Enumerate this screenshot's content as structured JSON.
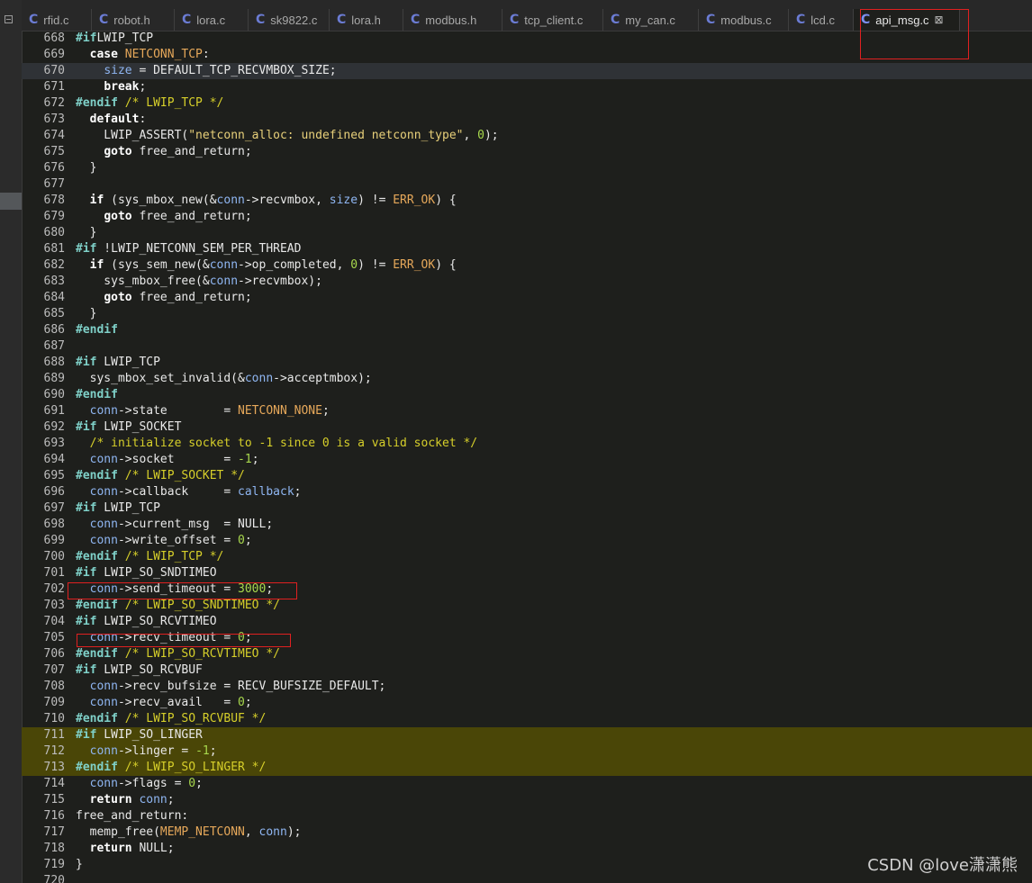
{
  "tabs": [
    {
      "label": "rfid.c"
    },
    {
      "label": "robot.h"
    },
    {
      "label": "lora.c"
    },
    {
      "label": "sk9822.c"
    },
    {
      "label": "lora.h"
    },
    {
      "label": "modbus.h"
    },
    {
      "label": "tcp_client.c"
    },
    {
      "label": "my_can.c"
    },
    {
      "label": "modbus.c"
    },
    {
      "label": "lcd.c"
    },
    {
      "label": "api_msg.c",
      "active": true
    }
  ],
  "tab_icon_glyph": "C",
  "close_glyph": "⊠",
  "lines": [
    {
      "n": "668",
      "hl": "",
      "seg": [
        [
          "pp",
          "#if"
        ],
        [
          "",
          "LWIP_TCP"
        ]
      ]
    },
    {
      "n": "669",
      "hl": "",
      "seg": [
        [
          "",
          "  "
        ],
        [
          "kw",
          "case"
        ],
        [
          "",
          ""
        ],
        [
          "mac",
          " NETCONN_TCP"
        ],
        [
          "",
          ":"
        ]
      ]
    },
    {
      "n": "670",
      "hl": "cur",
      "seg": [
        [
          "",
          "    "
        ],
        [
          "var",
          "size"
        ],
        [
          "",
          " = DEFAULT_TCP_RECVMBOX_SIZE;"
        ]
      ]
    },
    {
      "n": "671",
      "hl": "",
      "seg": [
        [
          "",
          "    "
        ],
        [
          "kw",
          "break"
        ],
        [
          "",
          ";"
        ]
      ]
    },
    {
      "n": "672",
      "hl": "",
      "seg": [
        [
          "pp",
          "#endif"
        ],
        [
          "cm",
          " /* LWIP_TCP */"
        ]
      ]
    },
    {
      "n": "673",
      "hl": "",
      "seg": [
        [
          "",
          "  "
        ],
        [
          "kw",
          "default"
        ],
        [
          "",
          ":"
        ]
      ]
    },
    {
      "n": "674",
      "hl": "",
      "seg": [
        [
          "",
          "    LWIP_ASSERT("
        ],
        [
          "str",
          "\"netconn_alloc: undefined netconn_type\""
        ],
        [
          "",
          ", "
        ],
        [
          "num",
          "0"
        ],
        [
          "",
          ");"
        ]
      ]
    },
    {
      "n": "675",
      "hl": "",
      "seg": [
        [
          "",
          "    "
        ],
        [
          "kw",
          "goto"
        ],
        [
          "",
          " free_and_return;"
        ]
      ]
    },
    {
      "n": "676",
      "hl": "",
      "seg": [
        [
          "",
          "  }"
        ]
      ]
    },
    {
      "n": "677",
      "hl": "",
      "seg": []
    },
    {
      "n": "678",
      "hl": "",
      "seg": [
        [
          "",
          "  "
        ],
        [
          "kw",
          "if"
        ],
        [
          "",
          " (sys_mbox_new(&"
        ],
        [
          "var",
          "conn"
        ],
        [
          "",
          "->recvmbox, "
        ],
        [
          "var",
          "size"
        ],
        [
          "",
          ") != "
        ],
        [
          "mac",
          "ERR_OK"
        ],
        [
          "",
          ") {"
        ]
      ]
    },
    {
      "n": "679",
      "hl": "",
      "seg": [
        [
          "",
          "    "
        ],
        [
          "kw",
          "goto"
        ],
        [
          "",
          " free_and_return;"
        ]
      ]
    },
    {
      "n": "680",
      "hl": "",
      "seg": [
        [
          "",
          "  }"
        ]
      ]
    },
    {
      "n": "681",
      "hl": "",
      "seg": [
        [
          "pp",
          "#if"
        ],
        [
          "",
          " !LWIP_NETCONN_SEM_PER_THREAD"
        ]
      ]
    },
    {
      "n": "682",
      "hl": "",
      "seg": [
        [
          "",
          "  "
        ],
        [
          "kw",
          "if"
        ],
        [
          "",
          " (sys_sem_new(&"
        ],
        [
          "var",
          "conn"
        ],
        [
          "",
          "->op_completed, "
        ],
        [
          "num",
          "0"
        ],
        [
          "",
          ") != "
        ],
        [
          "mac",
          "ERR_OK"
        ],
        [
          "",
          ") {"
        ]
      ]
    },
    {
      "n": "683",
      "hl": "",
      "seg": [
        [
          "",
          "    sys_mbox_free(&"
        ],
        [
          "var",
          "conn"
        ],
        [
          "",
          "->recvmbox);"
        ]
      ]
    },
    {
      "n": "684",
      "hl": "",
      "seg": [
        [
          "",
          "    "
        ],
        [
          "kw",
          "goto"
        ],
        [
          "",
          " free_and_return;"
        ]
      ]
    },
    {
      "n": "685",
      "hl": "",
      "seg": [
        [
          "",
          "  }"
        ]
      ]
    },
    {
      "n": "686",
      "hl": "",
      "seg": [
        [
          "pp",
          "#endif"
        ]
      ]
    },
    {
      "n": "687",
      "hl": "",
      "seg": []
    },
    {
      "n": "688",
      "hl": "",
      "seg": [
        [
          "pp",
          "#if"
        ],
        [
          "",
          " LWIP_TCP"
        ]
      ]
    },
    {
      "n": "689",
      "hl": "",
      "seg": [
        [
          "",
          "  sys_mbox_set_invalid(&"
        ],
        [
          "var",
          "conn"
        ],
        [
          "",
          "->acceptmbox);"
        ]
      ]
    },
    {
      "n": "690",
      "hl": "",
      "seg": [
        [
          "pp",
          "#endif"
        ]
      ]
    },
    {
      "n": "691",
      "hl": "",
      "seg": [
        [
          "",
          "  "
        ],
        [
          "var",
          "conn"
        ],
        [
          "",
          "->state        = "
        ],
        [
          "mac",
          "NETCONN_NONE"
        ],
        [
          "",
          ";"
        ]
      ]
    },
    {
      "n": "692",
      "hl": "",
      "seg": [
        [
          "pp",
          "#if"
        ],
        [
          "",
          " LWIP_SOCKET"
        ]
      ]
    },
    {
      "n": "693",
      "hl": "",
      "seg": [
        [
          "cm",
          "  /* initialize socket to -1 since 0 is a valid socket */"
        ]
      ]
    },
    {
      "n": "694",
      "hl": "",
      "seg": [
        [
          "",
          "  "
        ],
        [
          "var",
          "conn"
        ],
        [
          "",
          "->socket       = "
        ],
        [
          "num",
          "-1"
        ],
        [
          "",
          ";"
        ]
      ]
    },
    {
      "n": "695",
      "hl": "",
      "seg": [
        [
          "pp",
          "#endif"
        ],
        [
          "cm",
          " /* LWIP_SOCKET */"
        ]
      ]
    },
    {
      "n": "696",
      "hl": "",
      "seg": [
        [
          "",
          "  "
        ],
        [
          "var",
          "conn"
        ],
        [
          "",
          "->callback     = "
        ],
        [
          "var",
          "callback"
        ],
        [
          "",
          ";"
        ]
      ]
    },
    {
      "n": "697",
      "hl": "",
      "seg": [
        [
          "pp",
          "#if"
        ],
        [
          "",
          " LWIP_TCP"
        ]
      ]
    },
    {
      "n": "698",
      "hl": "",
      "seg": [
        [
          "",
          "  "
        ],
        [
          "var",
          "conn"
        ],
        [
          "",
          "->current_msg  = NULL;"
        ]
      ]
    },
    {
      "n": "699",
      "hl": "",
      "seg": [
        [
          "",
          "  "
        ],
        [
          "var",
          "conn"
        ],
        [
          "",
          "->write_offset = "
        ],
        [
          "num",
          "0"
        ],
        [
          "",
          ";"
        ]
      ]
    },
    {
      "n": "700",
      "hl": "",
      "seg": [
        [
          "pp",
          "#endif"
        ],
        [
          "cm",
          " /* LWIP_TCP */"
        ]
      ]
    },
    {
      "n": "701",
      "hl": "",
      "seg": [
        [
          "pp",
          "#if"
        ],
        [
          "",
          " LWIP_SO_SNDTIMEO"
        ]
      ]
    },
    {
      "n": "702",
      "hl": "",
      "seg": [
        [
          "",
          "  "
        ],
        [
          "var",
          "conn"
        ],
        [
          "",
          "->send_timeout = "
        ],
        [
          "num",
          "3000"
        ],
        [
          "",
          ";"
        ]
      ]
    },
    {
      "n": "703",
      "hl": "",
      "seg": [
        [
          "pp",
          "#endif"
        ],
        [
          "cm",
          " /* LWIP_SO_SNDTIMEO */"
        ]
      ]
    },
    {
      "n": "704",
      "hl": "",
      "seg": [
        [
          "pp",
          "#if"
        ],
        [
          "",
          " LWIP_SO_RCVTIMEO"
        ]
      ]
    },
    {
      "n": "705",
      "hl": "",
      "seg": [
        [
          "",
          "  "
        ],
        [
          "var",
          "conn"
        ],
        [
          "",
          "->recv_timeout = "
        ],
        [
          "num",
          "0"
        ],
        [
          "",
          ";"
        ]
      ]
    },
    {
      "n": "706",
      "hl": "",
      "seg": [
        [
          "pp",
          "#endif"
        ],
        [
          "cm",
          " /* LWIP_SO_RCVTIMEO */"
        ]
      ]
    },
    {
      "n": "707",
      "hl": "",
      "seg": [
        [
          "pp",
          "#if"
        ],
        [
          "",
          " LWIP_SO_RCVBUF"
        ]
      ]
    },
    {
      "n": "708",
      "hl": "",
      "seg": [
        [
          "",
          "  "
        ],
        [
          "var",
          "conn"
        ],
        [
          "",
          "->recv_bufsize = RECV_BUFSIZE_DEFAULT;"
        ]
      ]
    },
    {
      "n": "709",
      "hl": "",
      "seg": [
        [
          "",
          "  "
        ],
        [
          "var",
          "conn"
        ],
        [
          "",
          "->recv_avail   = "
        ],
        [
          "num",
          "0"
        ],
        [
          "",
          ";"
        ]
      ]
    },
    {
      "n": "710",
      "hl": "",
      "seg": [
        [
          "pp",
          "#endif"
        ],
        [
          "cm",
          " /* LWIP_SO_RCVBUF */"
        ]
      ]
    },
    {
      "n": "711",
      "hl": "yellow",
      "seg": [
        [
          "pp",
          "#if"
        ],
        [
          "",
          " LWIP_SO_LINGER"
        ]
      ]
    },
    {
      "n": "712",
      "hl": "yellow",
      "seg": [
        [
          "",
          "  "
        ],
        [
          "var",
          "conn"
        ],
        [
          "",
          "->linger = "
        ],
        [
          "num",
          "-1"
        ],
        [
          "",
          ";"
        ]
      ]
    },
    {
      "n": "713",
      "hl": "yellow",
      "seg": [
        [
          "pp",
          "#endif"
        ],
        [
          "cm",
          " /* LWIP_SO_LINGER */"
        ]
      ]
    },
    {
      "n": "714",
      "hl": "",
      "seg": [
        [
          "",
          "  "
        ],
        [
          "var",
          "conn"
        ],
        [
          "",
          "->flags = "
        ],
        [
          "num",
          "0"
        ],
        [
          "",
          ";"
        ]
      ]
    },
    {
      "n": "715",
      "hl": "",
      "seg": [
        [
          "",
          "  "
        ],
        [
          "kw",
          "return"
        ],
        [
          "",
          ""
        ],
        [
          "var",
          " conn"
        ],
        [
          "",
          ";"
        ]
      ]
    },
    {
      "n": "716",
      "hl": "",
      "seg": [
        [
          "",
          "free_and_return:"
        ]
      ]
    },
    {
      "n": "717",
      "hl": "",
      "seg": [
        [
          "",
          "  memp_free("
        ],
        [
          "mac",
          "MEMP_NETCONN"
        ],
        [
          "",
          ", "
        ],
        [
          "var",
          "conn"
        ],
        [
          "",
          ");"
        ]
      ]
    },
    {
      "n": "718",
      "hl": "",
      "seg": [
        [
          "",
          "  "
        ],
        [
          "kw",
          "return"
        ],
        [
          "",
          " NULL;"
        ]
      ]
    },
    {
      "n": "719",
      "hl": "",
      "seg": [
        [
          "",
          "}"
        ]
      ]
    },
    {
      "n": "720",
      "hl": "",
      "seg": []
    }
  ],
  "watermark": "CSDN @love潇潇熊"
}
